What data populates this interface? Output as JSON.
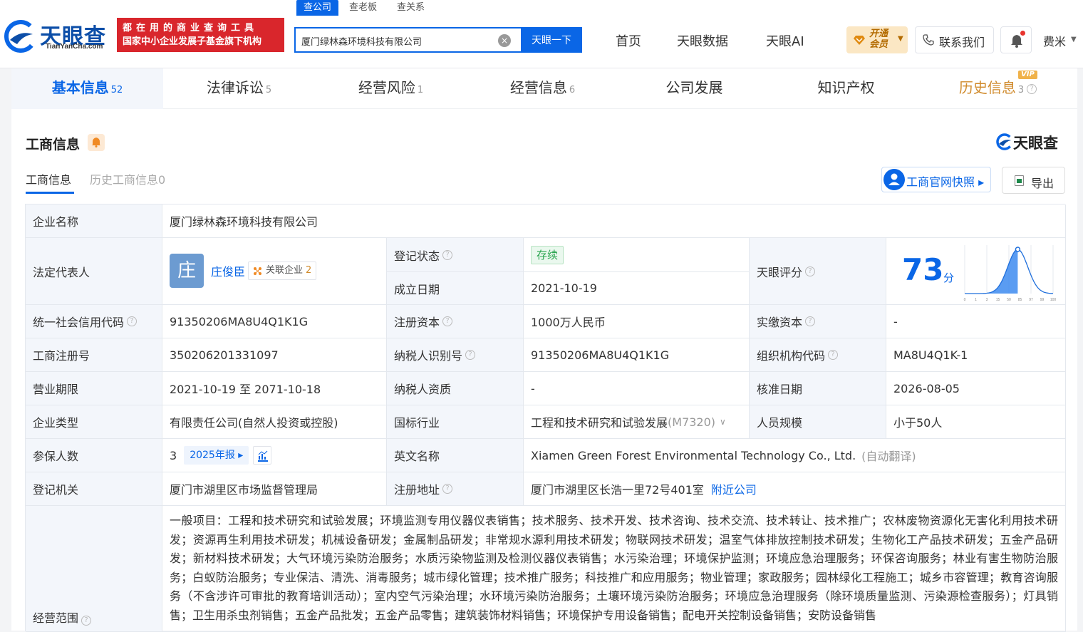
{
  "header": {
    "brand": "天眼查",
    "brand_domain": "TianYanCha.com",
    "banner_line1": "都在用的商业查询工具",
    "banner_line2": "国家中小企业发展子基金旗下机构",
    "search_tabs": [
      "查公司",
      "查老板",
      "查关系"
    ],
    "search_value": "厦门绿林森环境科技有限公司",
    "search_button": "天眼一下",
    "clear_icon_glyph": "×",
    "nav": [
      "首页",
      "天眼数据",
      "天眼AI"
    ],
    "vip_line1": "开通",
    "vip_line2": "会员",
    "contact": "联系我们",
    "user": "费米"
  },
  "tabs": [
    {
      "label": "基本信息",
      "count": "52"
    },
    {
      "label": "法律诉讼",
      "count": "5"
    },
    {
      "label": "经营风险",
      "count": "1"
    },
    {
      "label": "经营信息",
      "count": "6"
    },
    {
      "label": "公司发展",
      "count": ""
    },
    {
      "label": "知识产权",
      "count": ""
    },
    {
      "label": "历史信息",
      "count": "3",
      "badge": "VIP"
    }
  ],
  "section": {
    "title": "工商信息",
    "logo_text": "天眼查",
    "subtabs": [
      "工商信息",
      "历史工商信息0"
    ],
    "snapshot_button": "工商官网快照",
    "export_button": "导出"
  },
  "info": {
    "company_name_label": "企业名称",
    "company_name": "厦门绿林森环境科技有限公司",
    "legal_rep_label": "法定代表人",
    "legal_rep_avatar": "庄",
    "legal_rep_name": "庄俊臣",
    "assoc_label": "关联企业",
    "assoc_count": "2",
    "reg_status_label": "登记状态",
    "reg_status": "存续",
    "found_date_label": "成立日期",
    "found_date": "2021-10-19",
    "score_label": "天眼评分",
    "score": "73",
    "score_unit": "分",
    "score_axis": [
      "0",
      "1",
      "3",
      "15",
      "50",
      "85",
      "97",
      "99",
      "100"
    ],
    "credit_code_label": "统一社会信用代码",
    "credit_code": "91350206MA8U4Q1K1G",
    "reg_capital_label": "注册资本",
    "reg_capital": "1000万人民币",
    "paid_capital_label": "实缴资本",
    "paid_capital": "-",
    "reg_no_label": "工商注册号",
    "reg_no": "350206201331097",
    "taxpayer_id_label": "纳税人识别号",
    "taxpayer_id": "91350206MA8U4Q1K1G",
    "org_code_label": "组织机构代码",
    "org_code": "MA8U4Q1K-1",
    "term_label": "营业期限",
    "term": "2021-10-19 至 2071-10-18",
    "taxpayer_qual_label": "纳税人资质",
    "taxpayer_qual": "-",
    "approve_date_label": "核准日期",
    "approve_date": "2026-08-05",
    "type_label": "企业类型",
    "type": "有限责任公司(自然人投资或控股)",
    "industry_label": "国标行业",
    "industry": "工程和技术研究和试验发展",
    "industry_code": "(M7320)",
    "staff_label": "人员规模",
    "staff": "小于50人",
    "insured_label": "参保人数",
    "insured": "3",
    "report_tag": "2025年报",
    "english_label": "英文名称",
    "english_name": "Xiamen Green Forest Environmental Technology Co., Ltd.",
    "english_note": "(自动翻译)",
    "authority_label": "登记机关",
    "authority": "厦门市湖里区市场监督管理局",
    "address_label": "注册地址",
    "address": "厦门市湖里区长浩一里72号401室",
    "nearby": "附近公司",
    "scope_label": "经营范围",
    "scope": "一般项目：工程和技术研究和试验发展；环境监测专用仪器仪表销售；技术服务、技术开发、技术咨询、技术交流、技术转让、技术推广；农林废物资源化无害化利用技术研发；资源再生利用技术研发；机械设备研发；金属制品研发；非常规水源利用技术研发；物联网技术研发；温室气体排放控制技术研发；生物化工产品技术研发；五金产品研发；新材料技术研发；大气环境污染防治服务；水质污染物监测及检测仪器仪表销售；水污染治理；环境保护监测；环境应急治理服务；环保咨询服务；林业有害生物防治服务；白蚁防治服务；专业保洁、清洗、消毒服务；城市绿化管理；技术推广服务；科技推广和应用服务；物业管理；家政服务；园林绿化工程施工；城乡市容管理；教育咨询服务（不含涉许可审批的教育培训活动）；室内空气污染治理；水环境污染防治服务；土壤环境污染防治服务；环境应急治理服务（除环境质量监测、污染源检查服务）；灯具销售；卫生用杀虫剂销售；五金产品批发；五金产品零售；建筑装饰材料销售；环境保护专用设备销售；配电开关控制设备销售；安防设备销售"
  },
  "colors": {
    "accent": "#0a66e6",
    "banner": "#d9262c",
    "status_green": "#2aa44f",
    "vip": "#d08a2b"
  }
}
